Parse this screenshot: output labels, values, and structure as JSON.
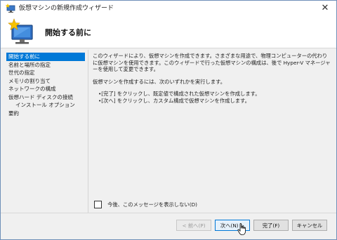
{
  "window": {
    "title": "仮想マシンの新規作成ウィザード",
    "close_glyph": "✕"
  },
  "header": {
    "title": "開始する前に"
  },
  "nav": {
    "items": [
      {
        "label": "開始する前に",
        "selected": true
      },
      {
        "label": "名前と場所の指定"
      },
      {
        "label": "世代の指定"
      },
      {
        "label": "メモリの割り当て"
      },
      {
        "label": "ネットワークの構成"
      },
      {
        "label": "仮想ハード ディスクの接続"
      },
      {
        "label": "インストール オプション",
        "indent": true
      },
      {
        "label": "要約"
      }
    ]
  },
  "content": {
    "intro": "このウィザードにより、仮想マシンを作成できます。さまざまな用途で、物理コンピューターの代わりに仮想マシンを使用できます。このウィザードで行った仮想マシンの構成は、後で Hyper-V マネージャーを使用して変更できます。",
    "instruction": "仮想マシンを作成するには、次のいずれかを実行します。",
    "bullets": [
      "•[完了] をクリックし、既定値で構成された仮想マシンを作成します。",
      "•[次へ] をクリックし、カスタム構成で仮想マシンを作成します。"
    ]
  },
  "checkbox": {
    "label": "今後、このメッセージを表示しない(D)",
    "checked": false
  },
  "buttons": {
    "prev": "< 前へ(P)",
    "next": "次へ(N) >",
    "finish": "完了(F)",
    "cancel": "キャンセル"
  },
  "colors": {
    "selection": "#0078d7",
    "window_border": "#6f8fb8"
  }
}
